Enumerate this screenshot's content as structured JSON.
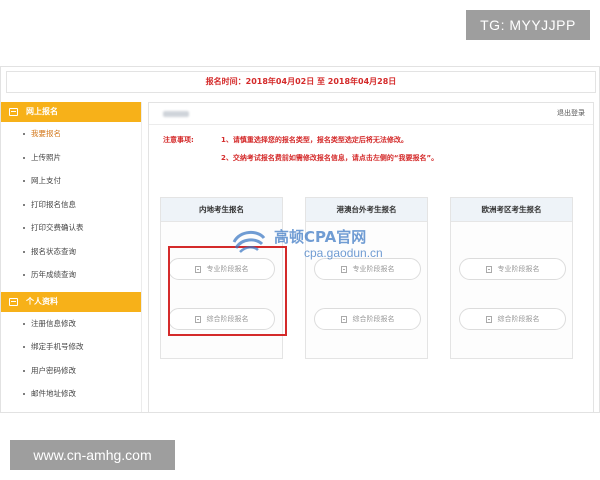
{
  "overlays": {
    "top_tag": "TG: MYYJJPP",
    "bottom_tag": "www.cn-amhg.com"
  },
  "header": {
    "registration_time": "报名时间：2018年04月02日 至 2018年04月28日"
  },
  "sidebar": {
    "sections": [
      {
        "title": "网上报名",
        "items": [
          "我要报名",
          "上传照片",
          "网上支付",
          "打印报名信息",
          "打印交费确认表",
          "报名状态查询",
          "历年成绩查询"
        ]
      },
      {
        "title": "个人资料",
        "items": [
          "注册信息修改",
          "绑定手机号修改",
          "用户密码修改",
          "邮件地址修改"
        ]
      }
    ],
    "active_item": "我要报名"
  },
  "main": {
    "logout_label": "退出登录",
    "notice_label": "注意事项:",
    "notices": [
      "1、请慎重选择您的报名类型，报名类型选定后将无法修改。",
      "2、交纳考试报名费前如需修改报名信息，请点击左侧的“我要报名”。"
    ],
    "panels": [
      {
        "title": "内地考生报名",
        "buttons": [
          "专业阶段报名",
          "综合阶段报名"
        ]
      },
      {
        "title": "港澳台外考生报名",
        "buttons": [
          "专业阶段报名",
          "综合阶段报名"
        ]
      },
      {
        "title": "欧洲考区考生报名",
        "buttons": [
          "专业阶段报名",
          "综合阶段报名"
        ]
      }
    ]
  },
  "watermark": {
    "title": "高顿CPA官网",
    "url": "cpa.gaodun.cn"
  },
  "colors": {
    "accent_orange": "#f7b119",
    "alert_red": "#d42a2a",
    "watermark_blue": "#3b78c4"
  }
}
